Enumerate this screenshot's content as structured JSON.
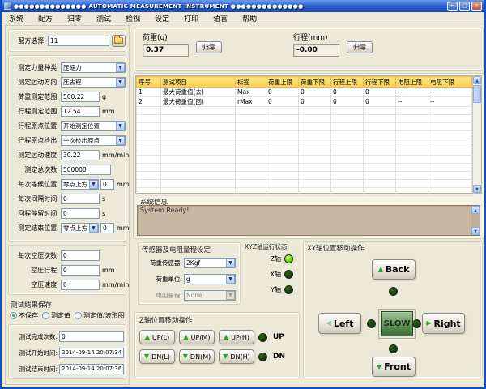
{
  "window": {
    "title": "●●●●●●●●●●●●●●   AUTOMATIC MEASUREMENT INSTRUMENT   ●●●●●●●●●●●●●●",
    "controls": {
      "minimize": "─",
      "maximize": "□",
      "close": "×"
    }
  },
  "menu": {
    "items": [
      "系统",
      "配方",
      "归零",
      "测试",
      "检视",
      "设定",
      "打印",
      "语言",
      "帮助"
    ]
  },
  "left": {
    "recipe_label": "配方选择:",
    "recipe_value": "11",
    "fields": [
      {
        "label": "测定力量种类:",
        "value": "压缩力"
      },
      {
        "label": "测定运动方向:",
        "value": "压去程"
      },
      {
        "label": "荷重测定范围:",
        "value": "500.22",
        "unit": "g"
      },
      {
        "label": "行程测定范围:",
        "value": "12.54",
        "unit": "mm"
      },
      {
        "label": "行程原点位置:",
        "value": "开始测定位置"
      },
      {
        "label": "行程原点检出:",
        "value": "一次检出原点"
      },
      {
        "label": "测定运动速度:",
        "value": "30.22",
        "unit": "mm/min"
      },
      {
        "label": "测定总次数:",
        "value": "500000"
      },
      {
        "label": "每次等候位置:",
        "select": "零点上方",
        "value": "0",
        "unit": "mm"
      },
      {
        "label": "每次间隔时间:",
        "value": "0",
        "unit": "s"
      },
      {
        "label": "回程停留时间:",
        "value": "0",
        "unit": "s"
      },
      {
        "label": "测定结束位置:",
        "select": "零点上方",
        "value": "0",
        "unit": "mm"
      }
    ],
    "air_fields": [
      {
        "label": "每次空压次数:",
        "value": "0",
        "unit": ""
      },
      {
        "label": "空压行程:",
        "value": "0",
        "unit": "mm"
      },
      {
        "label": "空压速度:",
        "value": "0",
        "unit": "mm/min"
      }
    ],
    "save_group": {
      "title": "测试结果保存",
      "options": [
        {
          "label": "不保存",
          "selected": true
        },
        {
          "label": "测定值",
          "selected": false
        },
        {
          "label": "测定值/波形图",
          "selected": false
        }
      ]
    },
    "result_fields": [
      {
        "label": "测试完成次数:",
        "value": "0"
      },
      {
        "label": "测试开始时间:",
        "value": "2014-09-14 20:07:34"
      },
      {
        "label": "测试结束时间:",
        "value": "2014-09-14 20:07:36"
      }
    ]
  },
  "readouts": {
    "load": {
      "label": "荷重(g)",
      "value": "0.37",
      "zero_label": "归零"
    },
    "stroke": {
      "label": "行程(mm)",
      "value": "-0.00",
      "zero_label": "归零"
    }
  },
  "table": {
    "headers": [
      "序号",
      "测试项目",
      "标签",
      "荷重上限",
      "荷重下限",
      "行程上限",
      "行程下限",
      "电阻上限",
      "电阻下限"
    ],
    "rows": [
      [
        "1",
        "最大荷重值(去)",
        "Max",
        "0",
        "0",
        "0",
        "0",
        "--",
        "--"
      ],
      [
        "2",
        "最大荷重值(回)",
        "rMax",
        "0",
        "0",
        "0",
        "0",
        "--",
        "--"
      ]
    ]
  },
  "system_info": {
    "label": "系统信息",
    "message": "System Ready!"
  },
  "sensor_panel": {
    "title": "传感器及电阻量程设定",
    "fields": [
      {
        "label": "荷重传感器:",
        "value": "2Kgf",
        "disabled": false
      },
      {
        "label": "荷重单位:",
        "value": "g",
        "disabled": false
      },
      {
        "label": "电阻量程:",
        "value": "None",
        "disabled": true
      }
    ]
  },
  "xyz_status": {
    "title": "XYZ轴运行状态",
    "axes": [
      {
        "label": "Z轴",
        "on": true
      },
      {
        "label": "X轴",
        "on": false
      },
      {
        "label": "Y轴",
        "on": false
      }
    ]
  },
  "z_move": {
    "title": "Z轴位置移动操作",
    "up_buttons": [
      "UP(L)",
      "UP(M)",
      "UP(H)"
    ],
    "down_buttons": [
      "DN(L)",
      "DN(M)",
      "DN(H)"
    ],
    "up_led_label": "UP",
    "dn_led_label": "DN"
  },
  "xy_move": {
    "title": "XY轴位置移动操作",
    "buttons": {
      "back": "Back",
      "front": "Front",
      "left": "Left",
      "right": "Right",
      "center": "SLOW"
    }
  },
  "colors": {
    "titlebar_blue": "#2f63d0",
    "table_header_gold": "#fbcf49",
    "led_on_green": "#5cdc04",
    "led_off_green": "#123708",
    "sysinfo_tan": "#c9b6a3",
    "accent_green": "#2ba52b"
  }
}
